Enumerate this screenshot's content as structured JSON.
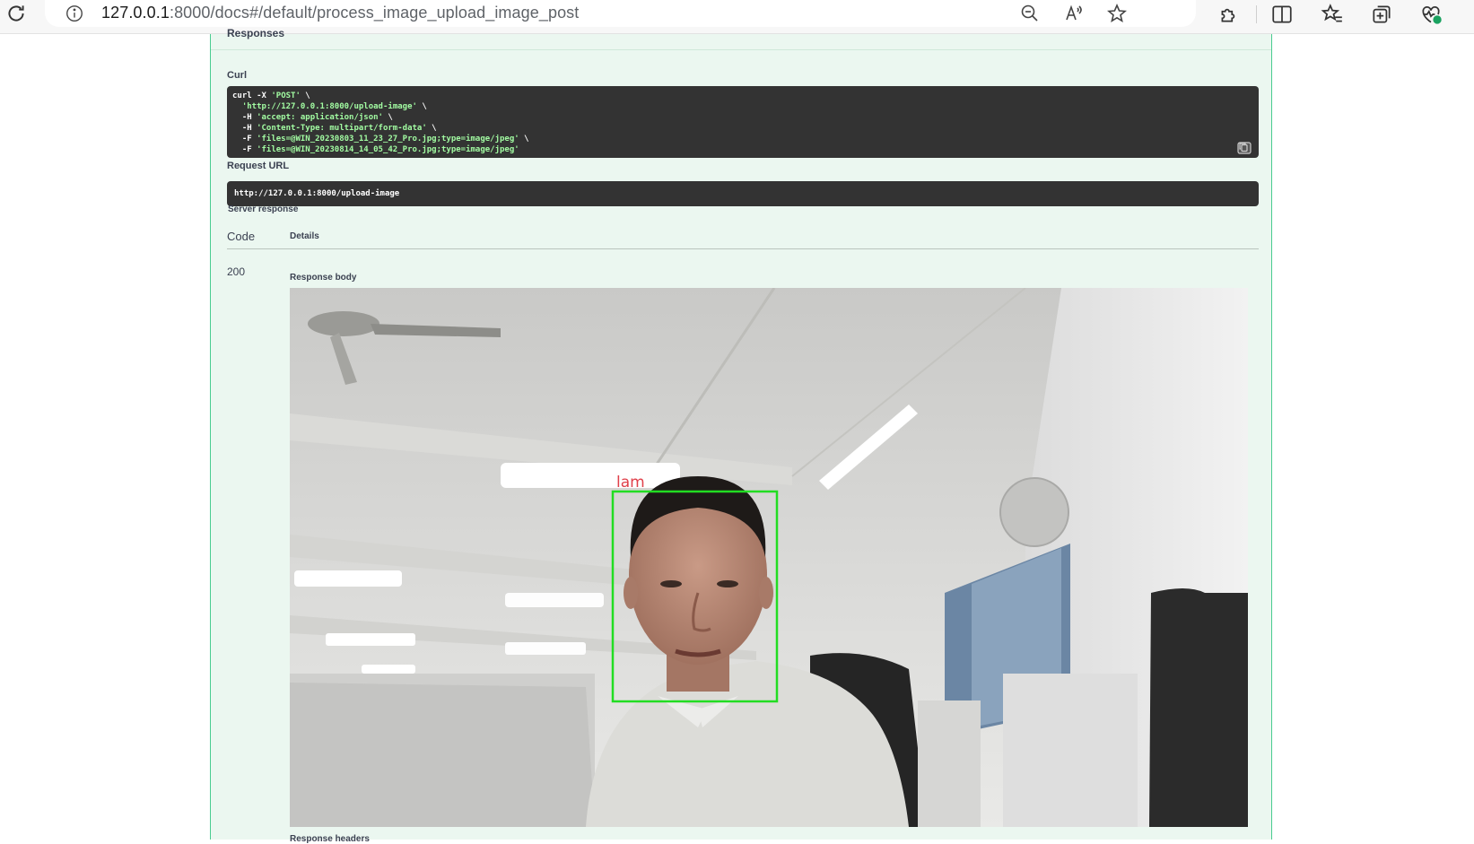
{
  "browser": {
    "url_host": "127.0.0.1",
    "url_path": ":8000/docs#/default/process_image_upload_image_post",
    "icons": [
      "reload-icon",
      "info-icon",
      "zoom-out-icon",
      "read-aloud-icon",
      "favorite-star-icon",
      "extensions-icon",
      "split-screen-icon",
      "favorites-icon",
      "collections-icon",
      "browser-essentials-icon"
    ]
  },
  "swagger": {
    "responses_title": "Responses",
    "curl_label": "Curl",
    "curl_lines": [
      {
        "prefix": "curl -X ",
        "value": "'POST'",
        "suffix": " \\"
      },
      {
        "prefix": "  ",
        "value": "'http://127.0.0.1:8000/upload-image'",
        "suffix": " \\"
      },
      {
        "prefix": "  -H ",
        "value": "'accept: application/json'",
        "suffix": " \\"
      },
      {
        "prefix": "  -H ",
        "value": "'Content-Type: multipart/form-data'",
        "suffix": " \\"
      },
      {
        "prefix": "  -F ",
        "value": "'files=@WIN_20230803_11_23_27_Pro.jpg;type=image/jpeg'",
        "suffix": " \\"
      },
      {
        "prefix": "  -F ",
        "value": "'files=@WIN_20230814_14_05_42_Pro.jpg;type=image/jpeg'",
        "suffix": ""
      }
    ],
    "request_url_label": "Request URL",
    "request_url": "http://127.0.0.1:8000/upload-image",
    "server_response_label": "Server response",
    "col_code": "Code",
    "col_details": "Details",
    "status_code": "200",
    "response_body_label": "Response body",
    "response_headers_label": "Response headers",
    "detection": {
      "name": "lam",
      "box_color": "#22dd22",
      "label_color": "#e0404a"
    }
  },
  "colors": {
    "opblock_bg": "#ebf7f0",
    "opblock_border": "#49cc90",
    "code_bg": "#333333",
    "code_string": "#a2fca2"
  }
}
